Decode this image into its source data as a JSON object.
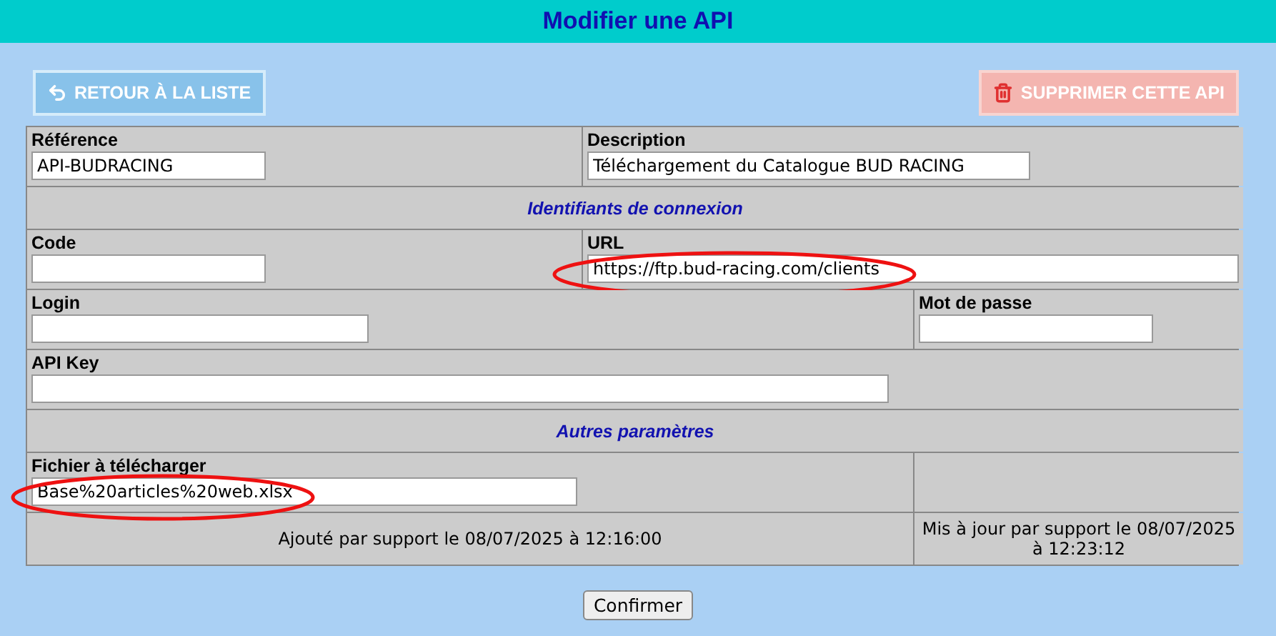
{
  "title": "Modifier une API",
  "actions": [
    {
      "kind": "back",
      "label": "RETOUR À LA LISTE"
    },
    {
      "kind": "delete",
      "label": "SUPPRIMER CETTE API"
    }
  ],
  "rows": [
    {
      "kind": "fields",
      "cells": [
        {
          "label": "Référence",
          "value": "API-BUDRACING"
        },
        {
          "label": "Description",
          "value": "Téléchargement du Catalogue BUD RACING"
        }
      ]
    },
    {
      "kind": "section",
      "title": "Identifiants de connexion"
    },
    {
      "kind": "fields",
      "cells": [
        {
          "label": "Code"
        },
        {
          "label": "URL",
          "value": "https://ftp.bud-racing.com/clients",
          "circled": true
        }
      ]
    },
    {
      "kind": "fields",
      "cells": [
        {
          "label": "Login"
        },
        {
          "label": "Mot de passe"
        }
      ]
    },
    {
      "kind": "fields",
      "cells": [
        {
          "label": "API Key"
        }
      ]
    },
    {
      "kind": "section",
      "title": "Autres paramètres"
    },
    {
      "kind": "fields",
      "cells": [
        {
          "label": "Fichier à télécharger",
          "value": "Base%20articles%20web.xlsx",
          "circled": true
        }
      ]
    },
    {
      "kind": "info",
      "cells": [
        "Ajouté par support le 08/07/2025 à 12:16:00",
        "Mis à jour par support le 08/07/2025 à 12:23:12"
      ]
    }
  ],
  "submit": "Confirmer"
}
